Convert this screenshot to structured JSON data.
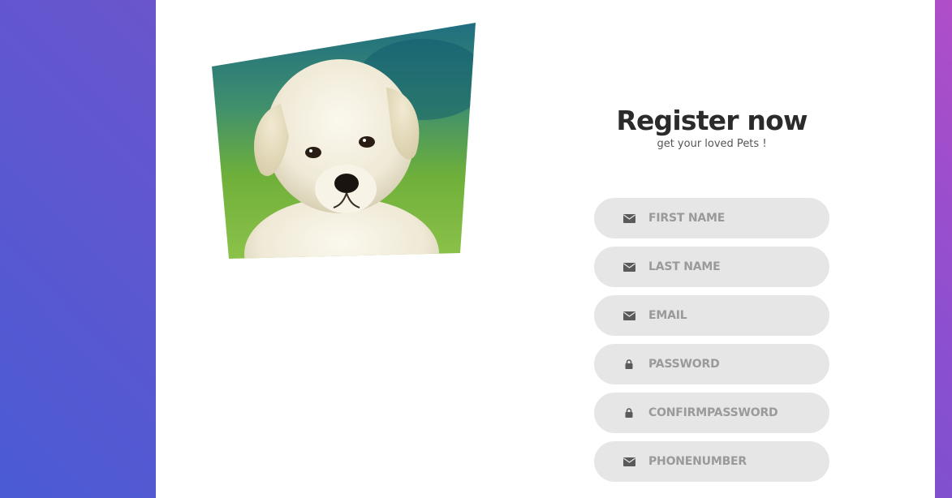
{
  "header": {
    "title": "Register now",
    "subtitle": "get your loved Pets !"
  },
  "image": {
    "subject": "puppy photo"
  },
  "form": {
    "fields": [
      {
        "placeholder": "FIRST NAME",
        "icon": "envelope-icon"
      },
      {
        "placeholder": "LAST NAME",
        "icon": "envelope-icon"
      },
      {
        "placeholder": "EMAIL",
        "icon": "envelope-icon"
      },
      {
        "placeholder": "PASSWORD",
        "icon": "lock-icon"
      },
      {
        "placeholder": "CONFIRMPASSWORD",
        "icon": "lock-icon"
      },
      {
        "placeholder": "PHONENUMBER",
        "icon": "envelope-icon"
      }
    ]
  },
  "colors": {
    "gradient_start": "#4a5bd4",
    "gradient_end": "#b04ec8",
    "field_bg": "#e6e6e6",
    "title": "#2b2b2b"
  }
}
